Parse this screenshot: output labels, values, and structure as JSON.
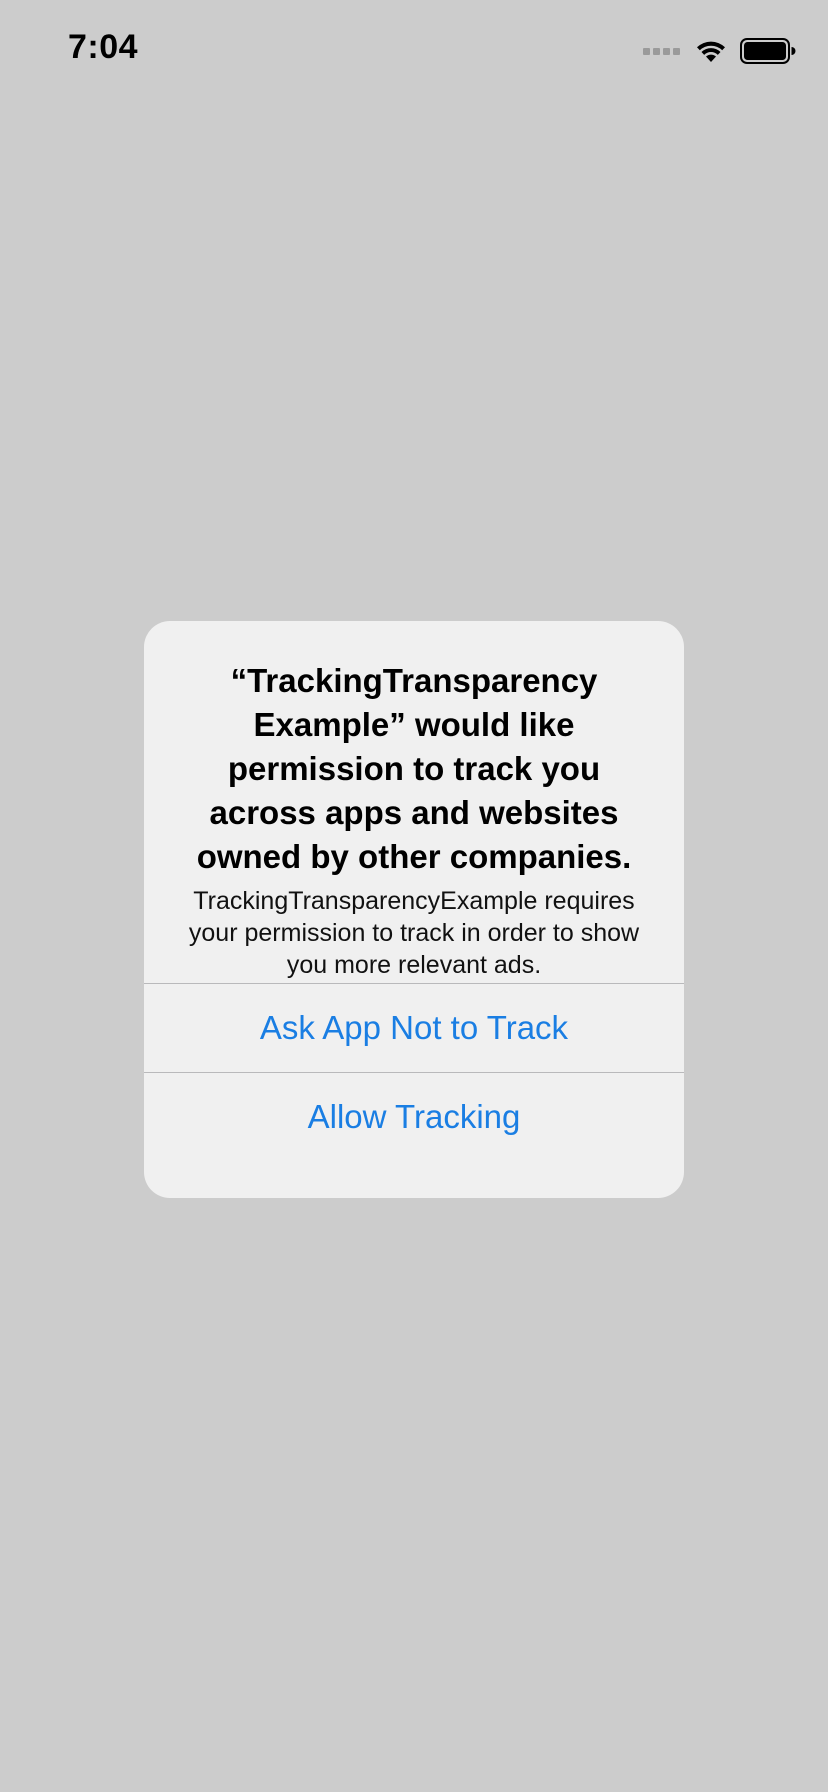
{
  "status_bar": {
    "time": "7:04",
    "icons": [
      "cellular-signal-icon",
      "wifi-icon",
      "battery-icon"
    ]
  },
  "alert": {
    "title": "“TrackingTransparency Example” would like permission to track you across apps and websites owned by other companies.",
    "message": "TrackingTransparencyExample requires your permission to track in order to show you more relevant ads.",
    "buttons": [
      {
        "label": "Ask App Not to Track"
      },
      {
        "label": "Allow Tracking"
      }
    ]
  },
  "colors": {
    "background": "#cccccc",
    "alert_background": "#f0f0f0",
    "button_text": "#1a7ee3",
    "divider": "#b9b9bb"
  }
}
